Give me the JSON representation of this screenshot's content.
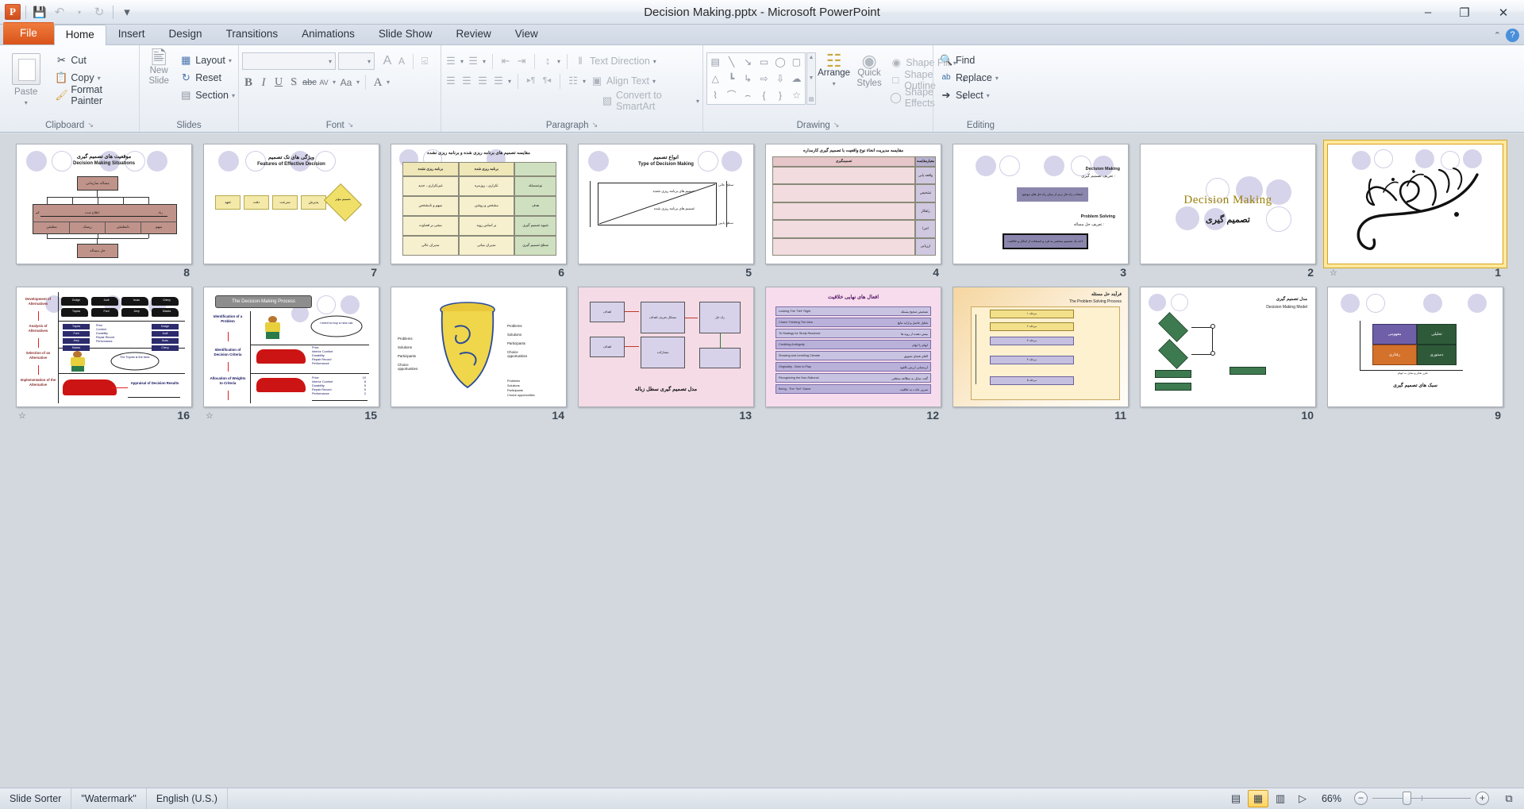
{
  "window": {
    "title": "Decision Making.pptx  -  Microsoft PowerPoint",
    "minimize": "–",
    "restore": "❐",
    "close": "✕"
  },
  "quick_access": {
    "app_icon_letter": "P",
    "items": [
      {
        "name": "save-icon",
        "glyph": "💾"
      },
      {
        "name": "undo-icon",
        "glyph": "↶"
      },
      {
        "name": "undo-dropdown-icon",
        "glyph": "▾"
      },
      {
        "name": "redo-icon",
        "glyph": "↻"
      },
      {
        "name": "customize-qat-icon",
        "glyph": "▾"
      }
    ]
  },
  "tabs": [
    {
      "label": "File",
      "active": false,
      "file": true
    },
    {
      "label": "Home",
      "active": true
    },
    {
      "label": "Insert",
      "active": false
    },
    {
      "label": "Design",
      "active": false
    },
    {
      "label": "Transitions",
      "active": false
    },
    {
      "label": "Animations",
      "active": false
    },
    {
      "label": "Slide Show",
      "active": false
    },
    {
      "label": "Review",
      "active": false
    },
    {
      "label": "View",
      "active": false
    }
  ],
  "tab_right": {
    "minimize_ribbon_icon": "⌃",
    "help_icon": "?"
  },
  "ribbon": {
    "clipboard": {
      "label": "Clipboard",
      "paste": "Paste",
      "cut": "Cut",
      "copy": "Copy",
      "format_painter": "Format Painter",
      "dialog_launcher": "↘"
    },
    "slides": {
      "label": "Slides",
      "new_slide": "New\nSlide",
      "new_slide_l1": "New",
      "new_slide_l2": "Slide",
      "layout": "Layout",
      "reset": "Reset",
      "section": "Section"
    },
    "font": {
      "label": "Font",
      "font_name_value": "",
      "font_size_value": "",
      "grow_font": "A",
      "shrink_font": "A",
      "clear_formatting": "Aa",
      "bold": "B",
      "italic": "I",
      "underline": "U",
      "shadow": "S",
      "strikethrough": "abc",
      "character_spacing": "AV",
      "change_case": "Aa",
      "font_color": "A",
      "dialog_launcher": "↘"
    },
    "paragraph": {
      "label": "Paragraph",
      "bullets": "☰",
      "numbering": "☰",
      "decrease_indent": "⇤",
      "increase_indent": "⇥",
      "line_spacing": "↕",
      "align_left": "☰",
      "align_center": "☰",
      "align_right": "☰",
      "justify": "☰",
      "text_direction": "Text Direction",
      "align_text": "Align Text",
      "convert_to_smartart": "Convert to SmartArt",
      "columns": "☷",
      "ltr": "▸¶",
      "rtl": "¶◂",
      "dialog_launcher": "↘"
    },
    "drawing": {
      "label": "Drawing",
      "shapes": [
        "▤",
        "╲",
        "↘",
        "▭",
        "◯",
        "▢",
        "△",
        "┗",
        "↳",
        "⇨",
        "⇩",
        "☁",
        "⌇",
        "⌒",
        "⌢",
        "{",
        "}",
        "☆"
      ],
      "arrange": "Arrange",
      "quick_styles_l1": "Quick",
      "quick_styles_l2": "Styles",
      "shape_fill": "Shape Fill",
      "shape_outline": "Shape Outline",
      "shape_effects": "Shape Effects",
      "dialog_launcher": "↘"
    },
    "editing": {
      "label": "Editing",
      "find": "Find",
      "replace": "Replace",
      "select": "Select"
    }
  },
  "slides": [
    {
      "number": "8",
      "has_transition": false,
      "selected": false,
      "kind": "org-chart",
      "title_fa": "موقعیت های تصمیم گیری",
      "title_en": "Decision Making Situations",
      "top_box": "مساله سازمانی",
      "bottom_box": "حل مساله",
      "cells": [
        "مطمئن",
        "ریسک",
        "نامطمئن",
        "مبهم"
      ],
      "axis_left": "کم",
      "axis_mid": "اطلاع شده",
      "axis_right": "زیاد"
    },
    {
      "number": "7",
      "has_transition": false,
      "selected": false,
      "kind": "features",
      "title_fa": "ویژگی های تک تصمیم",
      "title_en": "Features of Effective Decision",
      "boxes": [
        "تعهد",
        "دقت",
        "سرعت",
        "پذیرش"
      ],
      "diamond": "تصمیم مؤثر"
    },
    {
      "number": "6",
      "has_transition": false,
      "selected": false,
      "kind": "table",
      "title_fa": "مقایسه تصمیم های برنامه ریزی شده و برنامه ریزی نشده",
      "headers": [
        "برنامه ریزی نشده",
        "برنامه ریزی شده",
        ""
      ],
      "rows": [
        [
          "غیرتکراری ، جدید",
          "تکراری ، روزمره",
          "نوعمسئله"
        ],
        [
          "مبهم و نامشخص",
          "مشخص و روشن",
          "هدف"
        ],
        [
          "مبتنی بر قضاوت",
          "بر اساس رویه",
          "شیوه تصمیم گیری"
        ],
        [
          "مدیران عالی",
          "مدیران میانی",
          "سطح تصمیم گیری"
        ]
      ]
    },
    {
      "number": "5",
      "has_transition": false,
      "selected": false,
      "kind": "types",
      "title_fa": "انواع تصمیم",
      "title_en": "Type of Decision Making",
      "label_a": "تصمیم های برنامه ریزی شده",
      "label_b": "تصمیم های برنامه ریزی نشده",
      "side_top": "سطح عالی",
      "side_bottom": "سطح پایین"
    },
    {
      "number": "4",
      "has_transition": false,
      "selected": false,
      "kind": "bigtable",
      "title_fa": "مقایسه مدیریت انحاء نوع واقعیت با تصمیم گیری کارمداره",
      "col_head_right": "معیارمقایسه",
      "col_head_left": "تصمیمگیری",
      "side_labels": [
        "واقعه یابی",
        "تشخیص",
        "راهکار",
        "اجرا",
        "ارزیابی"
      ]
    },
    {
      "number": "3",
      "has_transition": false,
      "selected": false,
      "kind": "definitions",
      "dm_en": "Decision Making",
      "dm_fa": "تعریف تصمیم گیری :",
      "dm_box": "انتخاب راه حل برتر از میان راه حل های موجود.",
      "ps_en": "Problem Solving",
      "ps_fa": "تعریف حل مساله :",
      "ps_box": "اخذ یک تصمیم منحصر به فرد و استفاده از ابتکار و خلاقیت."
    },
    {
      "number": "2",
      "has_transition": false,
      "selected": false,
      "kind": "title",
      "title_en": "Decision Making",
      "title_fa": "تصمیم گیری"
    },
    {
      "number": "1",
      "has_transition": true,
      "selected": true,
      "kind": "bismillah",
      "calligraphy": "بسم الله الرحمن الرحیم"
    },
    {
      "number": "16",
      "has_transition": true,
      "selected": false,
      "kind": "cars-full",
      "steps": [
        "Development\nof\nAlternatives",
        "Analysis\nof\nAlternatives",
        "Selection\nof an\nAlternative",
        "Implementation\nof the\nAlternative"
      ],
      "step1": "Development of Alternatives",
      "step2": "Analysis of Alternatives",
      "step3": "Selection of an Alternative",
      "step4": "Implementation of the Alternative",
      "brands_row1": [
        "Dodge",
        "Audi",
        "Isuzu",
        "Chevy"
      ],
      "brands_row2": [
        "Toyota",
        "Ford",
        "Jeep",
        "Mazda"
      ],
      "list_left": [
        "Toyota",
        "Ford",
        "Jeep",
        "Mazda"
      ],
      "list_right": [
        "Dodge",
        "Audi",
        "Isuzu",
        "Chevy"
      ],
      "criteria": [
        "Price",
        "Comfort",
        "Durability",
        "Repair Record",
        "Performance"
      ],
      "bubble": "The Toyota is the best.",
      "appraisal": "Appraisal of Decision Results"
    },
    {
      "number": "15",
      "has_transition": true,
      "selected": false,
      "kind": "cars-process",
      "banner": "The Decision-Making Process",
      "steps": [
        "Identification of a Problem",
        "Identification of Decision Criteria",
        "Allocation of Weights to Criteria"
      ],
      "bubble": "I need to buy a new car.",
      "criteria": [
        "Price",
        "Interior Comfort",
        "Durability",
        "Repair Record",
        "Performance"
      ],
      "weights": [
        "10",
        "8",
        "5",
        "5",
        "2"
      ]
    },
    {
      "number": "14",
      "has_transition": false,
      "selected": false,
      "kind": "garbage-can",
      "left_labels": [
        "Problems",
        "Solutions",
        "Participants",
        "Choice opportunities"
      ],
      "right_labels": [
        "Problems",
        "Solutions",
        "Participants",
        "Choice opportunities"
      ],
      "legend": [
        "Problems",
        "Solutions",
        "Participants",
        "Choice opportunities"
      ]
    },
    {
      "number": "13",
      "has_transition": false,
      "selected": false,
      "kind": "garbage-model",
      "caption_fa": "مدل تصمیم گیری سطل زباله",
      "nodes": [
        "اهداف",
        "اهداف",
        "مشکل تعریف اهداف",
        "مشارکت",
        "راه حل"
      ]
    },
    {
      "number": "12",
      "has_transition": false,
      "selected": false,
      "kind": "list-purple",
      "title_fa": "افعال های نهایی خلاقیت",
      "rows_left": [
        "Looking The \"Set\" Right",
        "Charm Thinking The Idea",
        "To Strategy for Study Resolved",
        "Crediting Ambiguity",
        "Showing and Levelling Climate",
        "Originality - Born to Play",
        "Recognizing the Non-Rational",
        "Being - The \"Set\" Game"
      ],
      "rows_right": [
        "تشخیص صحیح مسئله",
        "تحلیل حاصل و ارایه نتایج",
        "بینش دهنده از رویه ها",
        "ابهام را ابهام",
        "القای فضای تشویق",
        "ارزشیابی ارزش بالقوه",
        "گفت تمایل به مطالعه منطقی",
        "تمرین عادت به خلاقیت"
      ]
    },
    {
      "number": "11",
      "has_transition": false,
      "selected": false,
      "kind": "process-orange",
      "title_fa": "فرآیند حل مسئله",
      "title_en": "The Problem  Solving  Process",
      "steps": [
        "مرحله ۱",
        "مرحله ۲",
        "مرحله ۳",
        "مرحله ۴",
        "مرحله ۵"
      ]
    },
    {
      "number": "10",
      "has_transition": false,
      "selected": false,
      "kind": "flowchart",
      "title_fa": "مدل تصمیم گیری",
      "title_en": "Decision Making Model"
    },
    {
      "number": "9",
      "has_transition": false,
      "selected": false,
      "kind": "grid4",
      "caption_fa": "سبک های تصمیم گیری",
      "cells": [
        "مفهومی",
        "تحلیلی",
        "رفتاری",
        "دستوری"
      ],
      "axis_label": "طرز تفکر و تمایل به ابهام"
    }
  ],
  "status_bar": {
    "view_name": "Slide Sorter",
    "theme": "\"Watermark\"",
    "language": "English (U.S.)",
    "zoom_level": "66%",
    "views": [
      {
        "name": "normal-view-button",
        "glyph": "▤",
        "active": false
      },
      {
        "name": "slide-sorter-view-button",
        "glyph": "▦",
        "active": true
      },
      {
        "name": "reading-view-button",
        "glyph": "▥",
        "active": false
      },
      {
        "name": "slide-show-button",
        "glyph": "▷",
        "active": false
      }
    ],
    "zoom_out": "−",
    "zoom_in": "+",
    "fit_to_window": "⧉"
  }
}
